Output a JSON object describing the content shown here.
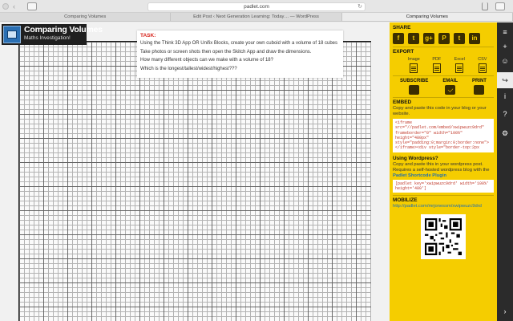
{
  "browser": {
    "url": "padlet.com",
    "tabs": [
      {
        "label": "Comparing Volumes",
        "active": false
      },
      {
        "label": "Edit Post ‹ Next Generation Learning: Today… — WordPress",
        "active": false
      },
      {
        "label": "Comparing Volumes",
        "active": true
      }
    ]
  },
  "padlet": {
    "title": "Comparing Volumes",
    "subtitle": "Maths Investigation!",
    "task": {
      "heading": "TASK:",
      "lines": [
        "Using the Think 3D App OR Unifix Blocks, create your own cuboid with a volume of 18 cubes",
        "Take photos or screen shots then open the Skitch App and draw the dimensions.",
        "How many different objects can we make with a volume of 18?",
        "Which is  the longest/tallest/widest/highest???"
      ]
    }
  },
  "panel": {
    "share": {
      "heading": "SHARE",
      "icons": [
        {
          "name": "facebook-icon",
          "glyph": "f"
        },
        {
          "name": "twitter-icon",
          "glyph": "t"
        },
        {
          "name": "googleplus-icon",
          "glyph": "g+"
        },
        {
          "name": "pinterest-icon",
          "glyph": "P"
        },
        {
          "name": "tumblr-icon",
          "glyph": "t"
        },
        {
          "name": "linkedin-icon",
          "glyph": "in"
        }
      ]
    },
    "export": {
      "heading": "EXPORT",
      "items": [
        "Image",
        "PDF",
        "Excel",
        "CSV"
      ]
    },
    "ses": {
      "subscribe": "SUBSCRIBE",
      "email": "EMAIL",
      "print": "PRINT"
    },
    "embed": {
      "heading": "EMBED",
      "text": "Copy and paste this code in your blog or your website.",
      "code": "<iframe\nsrc=\"//padlet.com/embed/xwipwuzc9drd\"\nframeborder=\"0\" width=\"100%\"\nheight=\"480px\"\nstyle=\"padding:0;margin:0;border:none\">\n</iframe><div style=\"border-top:2px"
    },
    "wordpress": {
      "heading": "Using Wordpress?",
      "text1": "Copy and paste this in your wordpress post.",
      "text2": "Requires a self-hosted wordpress blog with the",
      "link": "Padlet Shortcode Plugin",
      "code": "[padlet key='xwipwuzc9drd' width='100%'\nheight='480']"
    },
    "mobilize": {
      "heading": "MOBILIZE",
      "url": "http://padlet.com/mrjonessm/xwipwuzc9drd"
    }
  },
  "rail": {
    "buttons": [
      {
        "name": "menu-icon",
        "glyph": "≡",
        "active": false
      },
      {
        "name": "plus-icon",
        "glyph": "+",
        "active": false
      },
      {
        "name": "user-icon",
        "glyph": "☺",
        "active": false
      },
      {
        "name": "share-icon",
        "glyph": "↪",
        "active": true
      },
      {
        "name": "info-icon",
        "glyph": "i",
        "active": false
      },
      {
        "name": "question-icon",
        "glyph": "?",
        "active": false
      },
      {
        "name": "gear-icon",
        "glyph": "⚙",
        "active": false
      },
      {
        "name": "collapse-icon",
        "glyph": "›",
        "active": false
      }
    ]
  }
}
